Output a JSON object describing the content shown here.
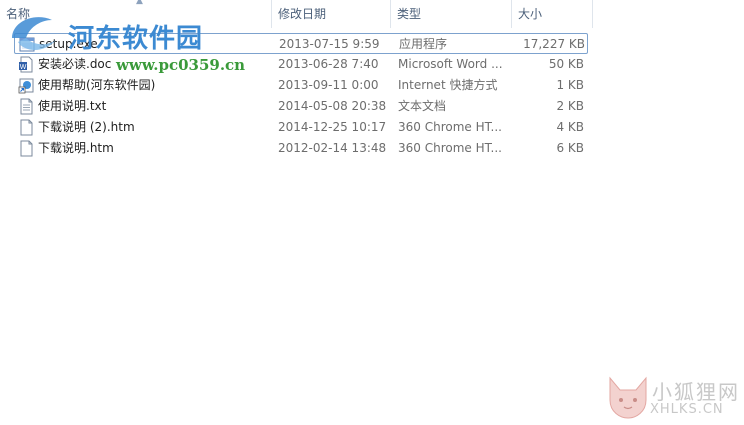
{
  "columns": {
    "name": "名称",
    "date": "修改日期",
    "type": "类型",
    "size": "大小"
  },
  "files": [
    {
      "name": "setup.exe",
      "date": "2013-07-15 9:59",
      "type": "应用程序",
      "size": "17,227 KB",
      "icon": "exe-icon",
      "selected": true
    },
    {
      "name": "安装必读.doc",
      "date": "2013-06-28 7:40",
      "type": "Microsoft Word ...",
      "size": "50 KB",
      "icon": "word-doc-icon"
    },
    {
      "name": "使用帮助(河东软件园)",
      "date": "2013-09-11 0:00",
      "type": "Internet 快捷方式",
      "size": "1 KB",
      "icon": "internet-shortcut-icon"
    },
    {
      "name": "使用说明.txt",
      "date": "2014-05-08 20:38",
      "type": "文本文档",
      "size": "2 KB",
      "icon": "text-file-icon"
    },
    {
      "name": "下载说明 (2).htm",
      "date": "2014-12-25 10:17",
      "type": "360 Chrome HT...",
      "size": "4 KB",
      "icon": "htm-file-icon"
    },
    {
      "name": "下载说明.htm",
      "date": "2012-02-14 13:48",
      "type": "360 Chrome HT...",
      "size": "6 KB",
      "icon": "htm-file-icon"
    }
  ],
  "watermarks": {
    "top_site": "河东软件园",
    "top_url": "www.pc0359.cn",
    "bottom_cn": "小狐狸网",
    "bottom_en": "XHLKS.CN"
  },
  "colors": {
    "header_text": "#4c607a",
    "selection_border": "#7da2ce",
    "watermark_blue": "#3c8ad2",
    "watermark_green": "#3a9a3a"
  }
}
